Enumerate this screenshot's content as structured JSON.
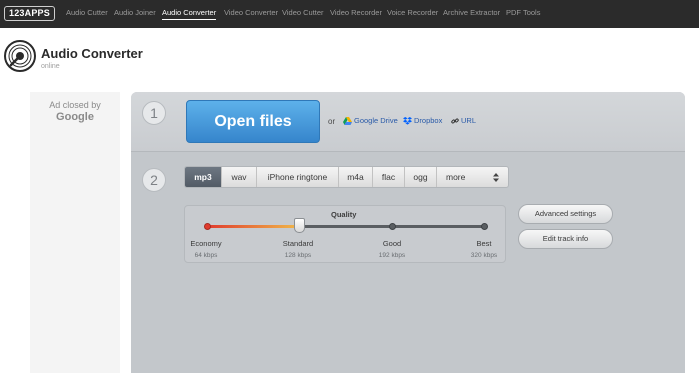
{
  "nav": {
    "logo": "123APPS",
    "items": [
      {
        "label": "Audio Cutter"
      },
      {
        "label": "Audio Joiner"
      },
      {
        "label": "Audio Converter",
        "active": true
      },
      {
        "label": "Video Converter"
      },
      {
        "label": "Video Cutter"
      },
      {
        "label": "Video Recorder"
      },
      {
        "label": "Voice Recorder"
      },
      {
        "label": "Archive Extractor"
      },
      {
        "label": "PDF Tools"
      }
    ]
  },
  "header": {
    "title": "Audio Converter",
    "subtitle": "online",
    "icon": "vinyl-disc-icon"
  },
  "ad": {
    "text": "Ad closed by",
    "brand": "Google"
  },
  "step1": {
    "number": "1",
    "open_button": "Open files",
    "or_text": "or",
    "sources": [
      {
        "label": "Google Drive",
        "icon": "google-drive-icon"
      },
      {
        "label": "Dropbox",
        "icon": "dropbox-icon"
      },
      {
        "label": "URL",
        "icon": "link-icon"
      }
    ]
  },
  "step2": {
    "number": "2",
    "formats": [
      "mp3",
      "wav",
      "iPhone ringtone",
      "m4a",
      "flac",
      "ogg"
    ],
    "more_label": "more",
    "selected_format": "mp3",
    "quality": {
      "title": "Quality",
      "selected_index": 1,
      "levels": [
        {
          "label": "Economy",
          "rate": "64 kbps"
        },
        {
          "label": "Standard",
          "rate": "128 kbps"
        },
        {
          "label": "Good",
          "rate": "192 kbps"
        },
        {
          "label": "Best",
          "rate": "320 kbps"
        }
      ]
    },
    "advanced_button": "Advanced settings",
    "edit_button": "Edit track info"
  },
  "colors": {
    "topbar": "#2b2b2b",
    "open_button": "#3f8fd6",
    "panel": "#c3c7cb",
    "link": "#2a5aa8",
    "slider_fill_start": "#e03b2e",
    "slider_fill_end": "#f0b84a"
  }
}
